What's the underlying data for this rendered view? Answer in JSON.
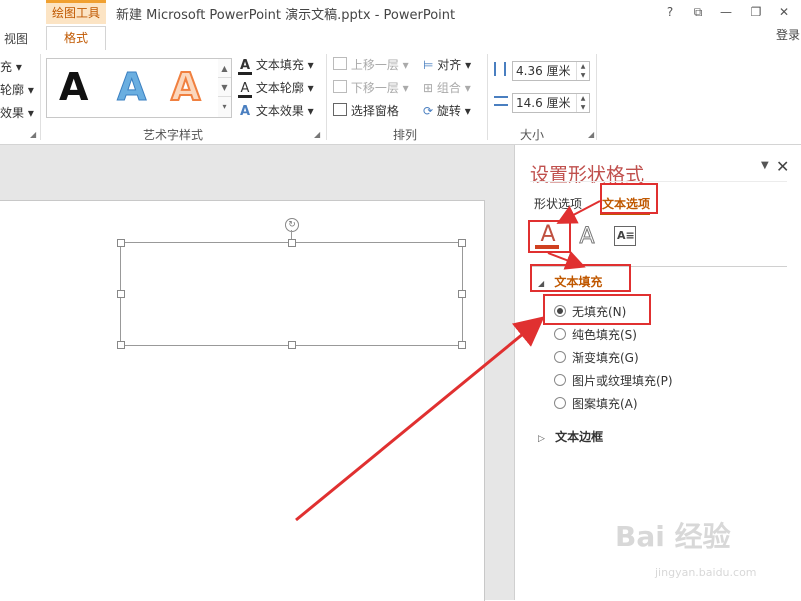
{
  "titlebar": {
    "context_tab": "绘图工具",
    "title": "新建 Microsoft PowerPoint 演示文稿.pptx - PowerPoint",
    "help": "?",
    "restore": "⧉",
    "minimize": "—",
    "maximize": "❐",
    "close": "✕"
  },
  "tabs": {
    "view": "视图",
    "format": "格式",
    "login": "登录"
  },
  "ribbon": {
    "left_clip": [
      "充 ▾",
      "轮廓 ▾",
      "效果 ▾"
    ],
    "wordart_samples": [
      "A",
      "A",
      "A"
    ],
    "text_fill": "文本填充 ▾",
    "text_outline": "文本轮廓 ▾",
    "text_effect": "文本效果 ▾",
    "group_wordart": "艺术字样式",
    "bring_forward": "上移一层 ▾",
    "send_backward": "下移一层 ▾",
    "selection_pane": "选择窗格",
    "align": "对齐 ▾",
    "group": "组合 ▾",
    "rotate": "旋转 ▾",
    "group_arrange": "排列",
    "height_value": "4.36 厘米",
    "width_value": "14.6 厘米",
    "group_size": "大小"
  },
  "pane": {
    "title": "设置形状格式",
    "tab_shape": "形状选项",
    "tab_text": "文本选项",
    "section_fill": "文本填充",
    "options": [
      "无填充(N)",
      "纯色填充(S)",
      "渐变填充(G)",
      "图片或纹理填充(P)",
      "图案填充(A)"
    ],
    "selected_index": 0,
    "section_border": "文本边框"
  },
  "watermark": {
    "brand": "Bai 经验",
    "url": "jingyan.baidu.com"
  },
  "colors": {
    "accent": "#c05800",
    "annotation_red": "#e03030",
    "pane_title": "#c0504d"
  }
}
